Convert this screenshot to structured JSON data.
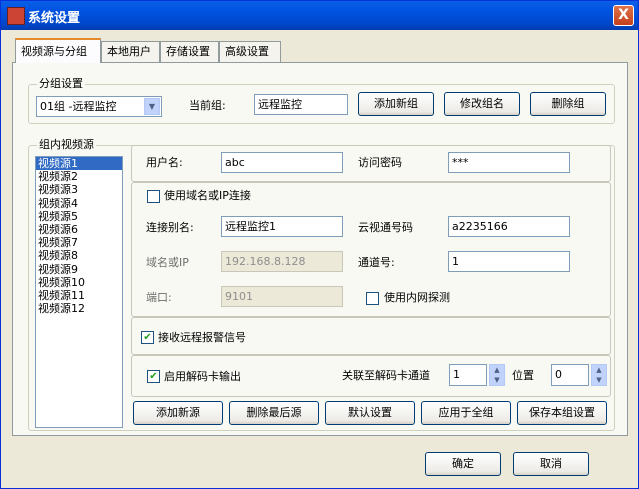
{
  "window": {
    "title": "系统设置",
    "close_label": "X"
  },
  "tabs": [
    {
      "label": "视频源与分组"
    },
    {
      "label": "本地用户"
    },
    {
      "label": "存储设置"
    },
    {
      "label": "高级设置"
    }
  ],
  "group_settings": {
    "legend": "分组设置",
    "group_select": "01组  -远程监控",
    "current_group_label": "当前组:",
    "current_group_value": "远程监控",
    "add_button": "添加新组",
    "modify_button": "修改组名",
    "delete_button": "删除组"
  },
  "sources": {
    "legend": "组内视频源",
    "items": [
      "视频源1",
      "视频源2",
      "视频源3",
      "视频源4",
      "视频源5",
      "视频源6",
      "视频源7",
      "视频源8",
      "视频源9",
      "视频源10",
      "视频源11",
      "视频源12"
    ]
  },
  "detail": {
    "username_label": "用户名:",
    "username_value": "abc",
    "password_label": "访问密码",
    "password_value": "***",
    "use_domain_label": "使用域名或IP连接",
    "alias_label": "连接别名:",
    "alias_value": "远程监控1",
    "cloud_label": "云视通号码",
    "cloud_value": "a2235166",
    "domain_label": "域名或IP",
    "domain_value": "192.168.8.128",
    "channel_label": "通道号:",
    "channel_value": "1",
    "port_label": "端口:",
    "port_value": "9101",
    "lan_probe_label": "使用内网探测",
    "alarm_label": "接收远程报警信号",
    "decode_label": "启用解码卡输出",
    "decode_channel_label": "关联至解码卡通道",
    "decode_channel_value": "1",
    "position_label": "位置",
    "position_value": "0"
  },
  "source_buttons": {
    "add": "添加新源",
    "delete_last": "删除最后源",
    "default": "默认设置",
    "apply_all": "应用于全组",
    "save_group": "保存本组设置"
  },
  "dialog_buttons": {
    "ok": "确定",
    "cancel": "取消"
  },
  "check_mark": "✔"
}
